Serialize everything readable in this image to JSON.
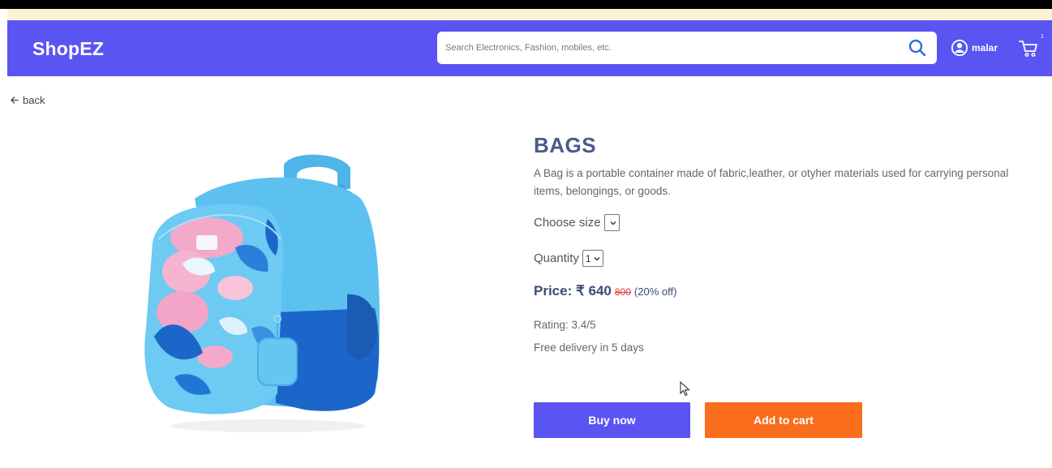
{
  "header": {
    "brand": "ShopEZ",
    "search_placeholder": "Search Electronics, Fashion, mobiles, etc.",
    "username": "malar",
    "cart_count": "1",
    "colors": {
      "navbar": "#5a54f2"
    }
  },
  "nav": {
    "back_label": "back"
  },
  "product": {
    "title": "BAGS",
    "description": "A Bag is a portable container made of fabric,leather, or otyher materials used for carrying personal items, belongings, or goods.",
    "choose_size_label": "Choose size",
    "size_value": "",
    "quantity_label": "Quantity",
    "quantity_value": "1",
    "price_label": "Price: ₹ 640",
    "old_price": "800",
    "discount": "(20% off)",
    "rating": "Rating: 3.4/5",
    "delivery": "Free delivery in 5 days"
  },
  "actions": {
    "buy_now": "Buy now",
    "add_to_cart": "Add to cart",
    "colors": {
      "buy_now": "#5a54f2",
      "add_to_cart": "#f96d1d"
    }
  }
}
